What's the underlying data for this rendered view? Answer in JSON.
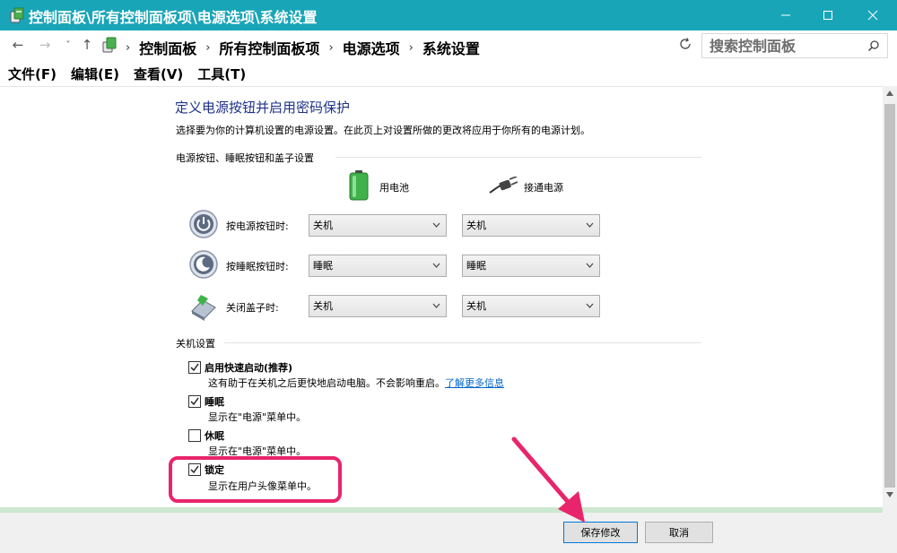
{
  "window": {
    "title": "控制面板\\所有控制面板项\\电源选项\\系统设置"
  },
  "address": {
    "breadcrumbs": [
      "控制面板",
      "所有控制面板项",
      "电源选项",
      "系统设置"
    ],
    "search_placeholder": "搜索控制面板"
  },
  "menu": [
    "文件(F)",
    "编辑(E)",
    "查看(V)",
    "工具(T)"
  ],
  "page": {
    "title": "定义电源按钮并启用密码保护",
    "description": "选择要为你的计算机设置的电源设置。在此页上对设置所做的更改将应用于你所有的电源计划。",
    "section_buttons": "电源按钮、睡眠按钮和盖子设置",
    "col_battery": "用电池",
    "col_plugged": "接通电源",
    "rows": [
      {
        "label": "按电源按钮时:",
        "battery": "关机",
        "plugged": "关机",
        "icon": "power-button-icon"
      },
      {
        "label": "按睡眠按钮时:",
        "battery": "睡眠",
        "plugged": "睡眠",
        "icon": "sleep-button-icon"
      },
      {
        "label": "关闭盖子时:",
        "battery": "关机",
        "plugged": "关机",
        "icon": "laptop-lid-icon"
      }
    ],
    "section_shutdown": "关机设置",
    "shutdown_options": [
      {
        "label": "启用快速启动(推荐)",
        "checked": true,
        "desc": "这有助于在关机之后更快地启动电脑。不会影响重启。",
        "link": "了解更多信息"
      },
      {
        "label": "睡眠",
        "checked": true,
        "desc": "显示在\"电源\"菜单中。"
      },
      {
        "label": "休眠",
        "checked": false,
        "desc": "显示在\"电源\"菜单中。"
      },
      {
        "label": "锁定",
        "checked": true,
        "desc": "显示在用户头像菜单中。"
      }
    ]
  },
  "buttons": {
    "save": "保存修改",
    "cancel": "取消"
  },
  "colors": {
    "titlebar": "#19a5b8",
    "heading": "#1e3287",
    "annotation": "#e8256c"
  }
}
